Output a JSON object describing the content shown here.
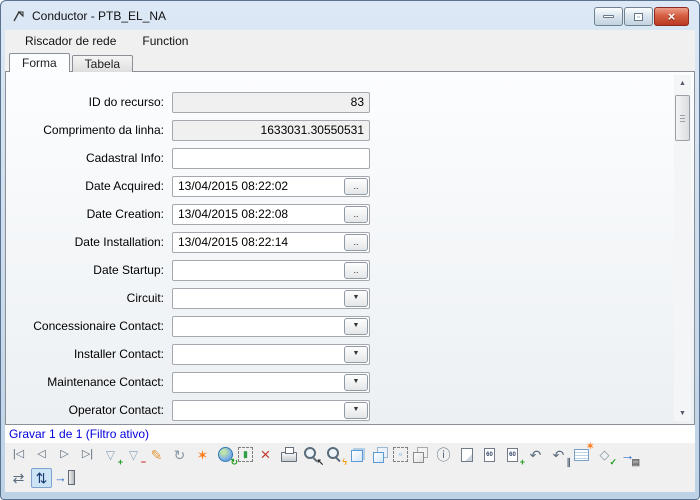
{
  "window": {
    "title": "Conductor - PTB_EL_NA",
    "controls": [
      "minimize",
      "restore",
      "close"
    ]
  },
  "menu": {
    "items": [
      "Riscador de rede",
      "Function"
    ]
  },
  "tabs": [
    {
      "label": "Forma",
      "active": true
    },
    {
      "label": "Tabela",
      "active": false
    }
  ],
  "form": {
    "rows": [
      {
        "label": "ID do recurso:",
        "value": "83",
        "readonly": true,
        "align": "right"
      },
      {
        "label": "Comprimento da linha:",
        "value": "1633031.30550531",
        "readonly": true,
        "align": "right"
      },
      {
        "label": "Cadastral Info:",
        "value": ""
      },
      {
        "label": "Date Acquired:",
        "value": "13/04/2015 08:22:02",
        "button": "ellipsis",
        "button_glyph": "..",
        "button_name": "date-picker-button"
      },
      {
        "label": "Date Creation:",
        "value": "13/04/2015 08:22:08",
        "button": "ellipsis",
        "button_glyph": "..",
        "button_name": "date-picker-button"
      },
      {
        "label": "Date Installation:",
        "value": "13/04/2015 08:22:14",
        "button": "ellipsis",
        "button_glyph": "..",
        "button_name": "date-picker-button"
      },
      {
        "label": "Date Startup:",
        "value": "",
        "button": "ellipsis",
        "button_glyph": "..",
        "button_name": "date-picker-button"
      },
      {
        "label": "Circuit:",
        "value": "",
        "button": "dropdown",
        "button_glyph": "▼",
        "button_name": "dropdown-button"
      },
      {
        "label": "Concessionaire Contact:",
        "value": "",
        "button": "dropdown",
        "button_glyph": "▼",
        "button_name": "dropdown-button"
      },
      {
        "label": "Installer Contact:",
        "value": "",
        "button": "dropdown",
        "button_glyph": "▼",
        "button_name": "dropdown-button"
      },
      {
        "label": "Maintenance Contact:",
        "value": "",
        "button": "dropdown",
        "button_glyph": "▼",
        "button_name": "dropdown-button"
      },
      {
        "label": "Operator Contact:",
        "value": "",
        "button": "dropdown",
        "button_glyph": "▼",
        "button_name": "dropdown-button"
      }
    ]
  },
  "status": {
    "text": "Gravar 1 de 1 (Filtro ativo)",
    "color": "#0000dd"
  },
  "toolbar_main": [
    {
      "name": "first-record-icon",
      "glyph": "|◁",
      "color": "#5a6b7c",
      "size": 11
    },
    {
      "name": "previous-record-icon",
      "glyph": "◁",
      "color": "#5a6b7c",
      "size": 11
    },
    {
      "name": "next-record-icon",
      "glyph": "▷",
      "color": "#5a6b7c",
      "size": 11
    },
    {
      "name": "last-record-icon",
      "glyph": "▷|",
      "color": "#5a6b7c",
      "size": 11
    },
    {
      "name": "add-filter-icon",
      "glyph": "▽",
      "color": "#8fa8bf",
      "size": 12,
      "badge": "+",
      "badgeColor": "#1f9e1f"
    },
    {
      "name": "remove-filter-icon",
      "glyph": "▽",
      "color": "#8fa8bf",
      "size": 12,
      "badge": "−",
      "badgeColor": "#cc2222"
    },
    {
      "name": "edit-pencil-icon",
      "glyph": "✎",
      "color": "#e09a3c",
      "size": 14
    },
    {
      "name": "refresh-icon",
      "glyph": "↻",
      "color": "#8a97a5",
      "size": 14
    },
    {
      "name": "spark-icon",
      "glyph": "✶",
      "color": "#ff7b1a",
      "size": 14
    },
    {
      "name": "globe-refresh-icon",
      "cls": "shape-globe",
      "badge": "↻",
      "badgeColor": "#1f9e1f"
    },
    {
      "name": "select-area-icon",
      "cls": "shape-dashed",
      "glyph": "▮",
      "color": "#2f9e44",
      "size": 9
    },
    {
      "name": "delete-icon",
      "glyph": "×",
      "color": "#c0392b",
      "size": 17
    },
    {
      "name": "print-icon",
      "cls": "shape-printer"
    },
    {
      "name": "zoom-pointer-icon",
      "cls": "shape-zoom",
      "badge": "↖",
      "badgeColor": "#222222"
    },
    {
      "name": "zoom-flash-icon",
      "cls": "shape-zoom",
      "badge": "ϟ",
      "badgeColor": "#f39c12"
    },
    {
      "name": "cube-icon",
      "cls": "shape-cube"
    },
    {
      "name": "cubes-copy-icon",
      "cls": "shape-cubes"
    },
    {
      "name": "cube-select-icon",
      "cls": "shape-dashed",
      "glyph": "▫",
      "color": "#5b9bd5",
      "size": 9
    },
    {
      "name": "cubes-gray-icon",
      "cls": "shape-cubes-gray"
    },
    {
      "name": "info-icon",
      "glyph": "ⓘ",
      "color": "#5a6b7c",
      "size": 14
    },
    {
      "name": "document-icon",
      "cls": "shape-doc"
    },
    {
      "name": "report-icon",
      "cls": "shape-report",
      "glyph": "60",
      "color": "#334466"
    },
    {
      "name": "add-report-icon",
      "cls": "shape-report",
      "glyph": "60",
      "color": "#334466",
      "badge": "+",
      "badgeColor": "#1f9e1f"
    },
    {
      "name": "trace-path-icon",
      "glyph": "↶",
      "color": "#5a6b7c",
      "size": 14
    },
    {
      "name": "trace-multipath-icon",
      "glyph": "↶",
      "color": "#5a6b7c",
      "size": 14,
      "badge": "∥",
      "badgeColor": "#5a6b7c"
    },
    {
      "name": "new-note-icon",
      "cls": "shape-note",
      "badge": "✶",
      "badgeColor": "#ff7b1a"
    },
    {
      "name": "validate-icon",
      "glyph": "◇",
      "color": "#8a97a5",
      "size": 13,
      "badge": "✓",
      "badgeColor": "#1f9e1f"
    },
    {
      "name": "export-data-icon",
      "glyph": "→",
      "color": "#2e6dcc",
      "size": 14,
      "badge": "▤",
      "badgeColor": "#666666"
    }
  ],
  "toolbar_secondary": [
    {
      "name": "network-flow-icon",
      "glyph": "⇄",
      "color": "#5a6b7c",
      "size": 14
    },
    {
      "name": "preferences-icon",
      "glyph": "⇅",
      "color": "#1a3c6e",
      "size": 14,
      "cls": "pressed"
    },
    {
      "name": "exit-icon",
      "glyph": "→",
      "color": "#2e6dcc",
      "size": 13,
      "cls": "shape-exit"
    }
  ],
  "colors": {
    "frame": "#bed2e6",
    "close_button": "#d55f43",
    "status_text": "#0000dd",
    "readonly_field_bg": "#f0f0f0",
    "field_border": "#a5a8ae",
    "toolbar_bg": "#f0f0f0",
    "pressed_icon_bg": "#cde4f7"
  }
}
